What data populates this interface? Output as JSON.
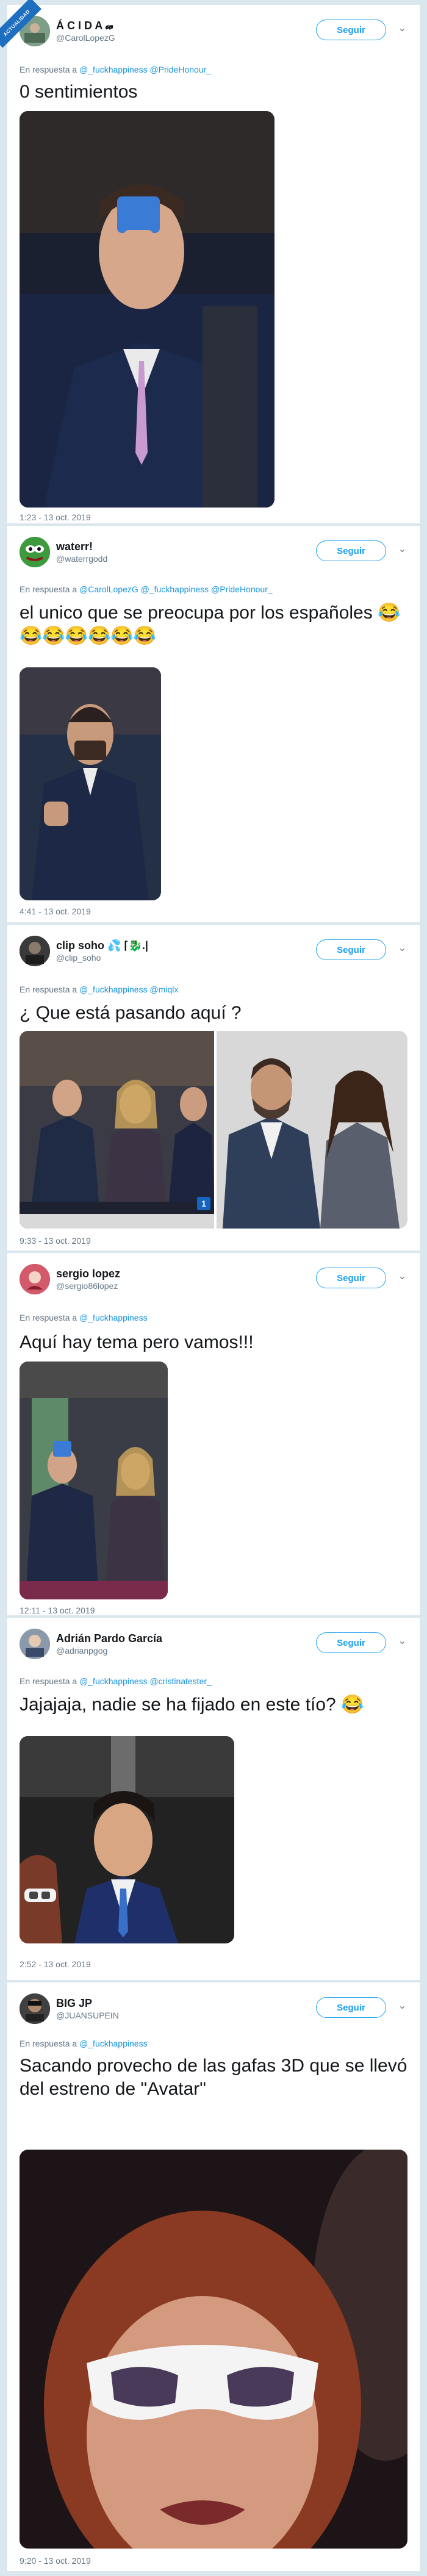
{
  "corner_badge": "ACTUALIDAD",
  "follow_label": "Seguir",
  "reply_prefix": "En respuesta a",
  "tweets": [
    {
      "display_name": "Á C I D A 𝔀",
      "handle": "@CarolLopezG",
      "reply_to": "@_fuckhappiness @PrideHonour_",
      "text": "0 sentimientos",
      "time": "1:23 - 13 oct. 2019"
    },
    {
      "display_name": "waterr!",
      "handle": "@waterrgodd",
      "reply_to": "@CarolLopezG @_fuckhappiness @PrideHonour_",
      "text": "el unico que se preocupa por los españoles 😂😂😂😂😂😂😂",
      "time": "4:41 - 13 oct. 2019"
    },
    {
      "display_name": "clip soho 💦 ⌈🐉.|",
      "handle": "@clip_soho",
      "reply_to": "@_fuckhappiness @miqlx",
      "text": "¿ Que está pasando aquí ?",
      "time": "9:33 - 13 oct. 2019",
      "video_badge": "1"
    },
    {
      "display_name": "sergio lopez",
      "handle": "@sergio86lopez",
      "reply_to": "@_fuckhappiness",
      "text": "Aquí hay tema pero vamos!!!",
      "time": "12:11 - 13 oct. 2019"
    },
    {
      "display_name": "Adrián Pardo García",
      "handle": "@adrianpgog",
      "reply_to": "@_fuckhappiness @cristinatester_",
      "text": "Jajajaja, nadie se ha fijado en este tío? 😂",
      "time": "2:52 - 13 oct. 2019"
    },
    {
      "display_name": "BIG JP",
      "handle": "@JUANSUPEIN",
      "reply_to": "@_fuckhappiness",
      "text": "Sacando provecho de las gafas 3D que se llevó del estreno de \"Avatar\"",
      "time": "9:20 - 13 oct. 2019"
    }
  ],
  "colors": {
    "page_bg": "#dbe7ef",
    "accent": "#1da1f2",
    "mention": "#1b95e0",
    "muted": "#657786"
  }
}
